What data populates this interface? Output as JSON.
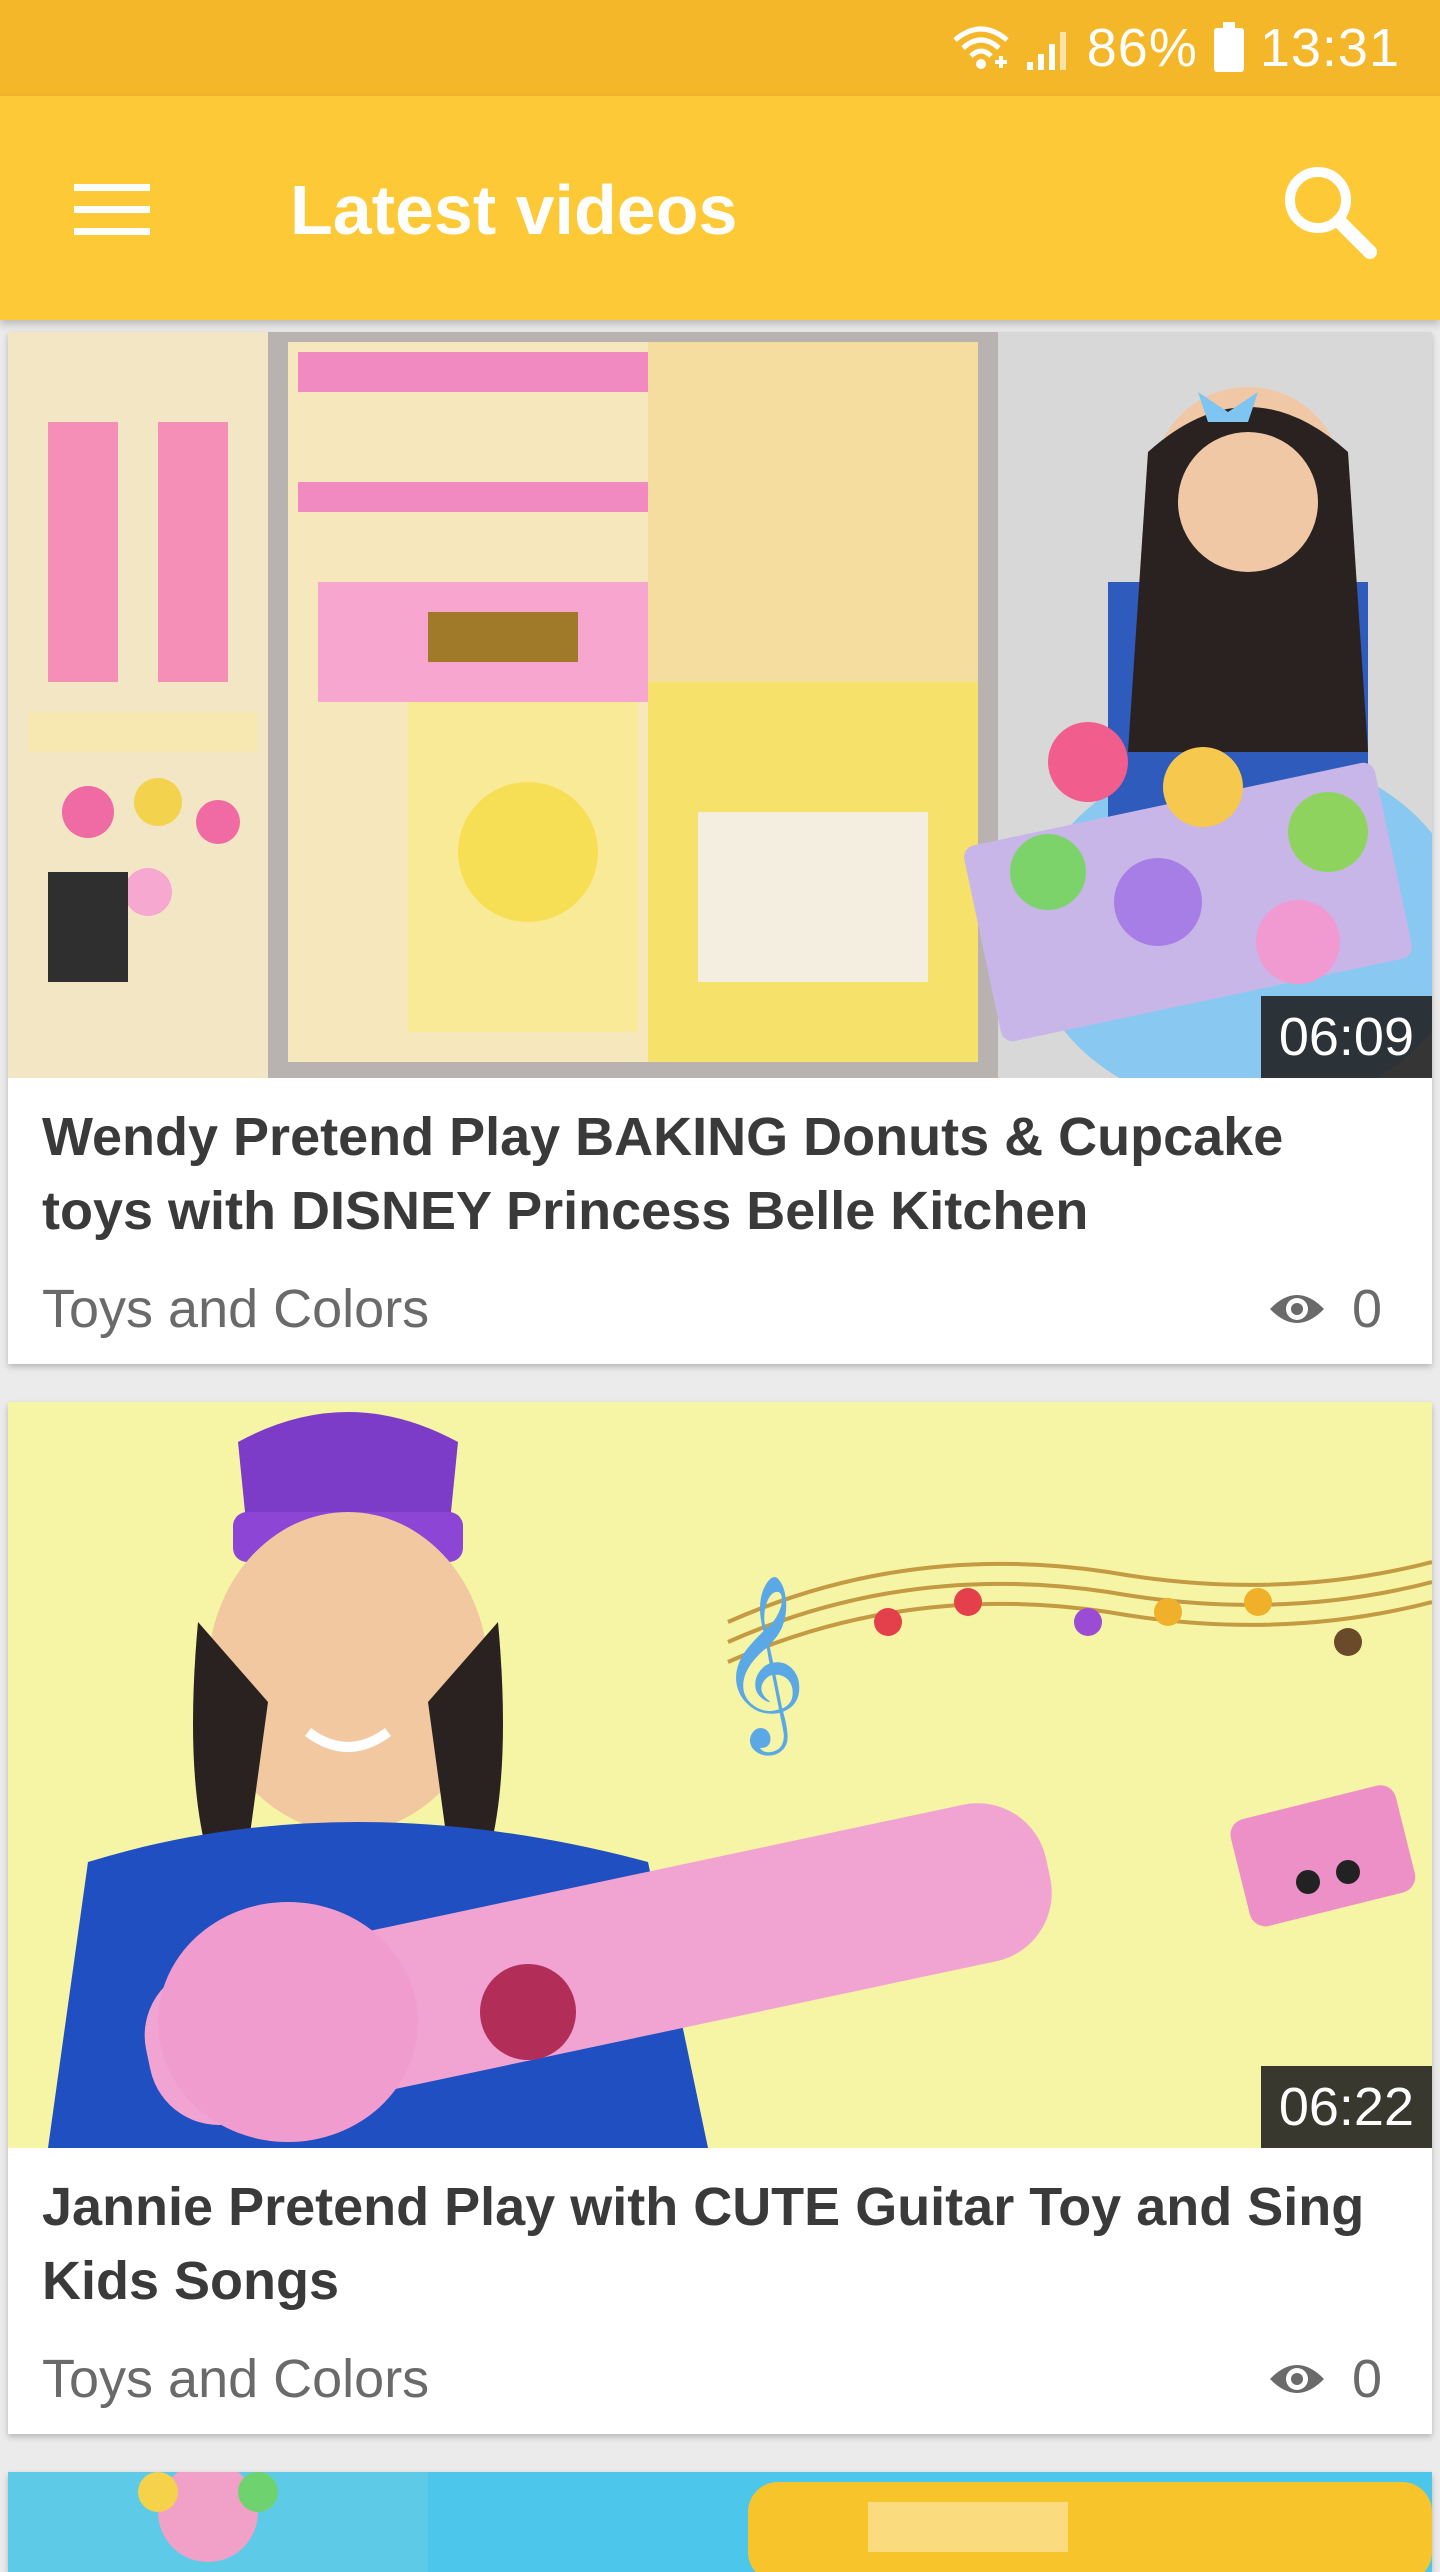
{
  "status_bar": {
    "battery": "86%",
    "time": "13:31",
    "icons": [
      "wifi-icon",
      "signal-icon",
      "battery-icon"
    ]
  },
  "app_bar": {
    "title": "Latest videos",
    "menu_icon": "menu-icon",
    "search_icon": "search-icon"
  },
  "colors": {
    "status_bar": "#f5b72a",
    "app_bar": "#fdc936",
    "background": "#ebebeb",
    "card": "#ffffff"
  },
  "videos": [
    {
      "title": "Wendy Pretend Play BAKING Donuts & Cupcake toys with DISNEY Princess Belle Kitchen",
      "duration": "06:09",
      "channel": "Toys and Colors",
      "views": "0",
      "views_icon": "eye-icon"
    },
    {
      "title": "Jannie Pretend Play with CUTE Guitar Toy and Sing Kids Songs",
      "duration": "06:22",
      "channel": "Toys and Colors",
      "views": "0",
      "views_icon": "eye-icon"
    }
  ]
}
